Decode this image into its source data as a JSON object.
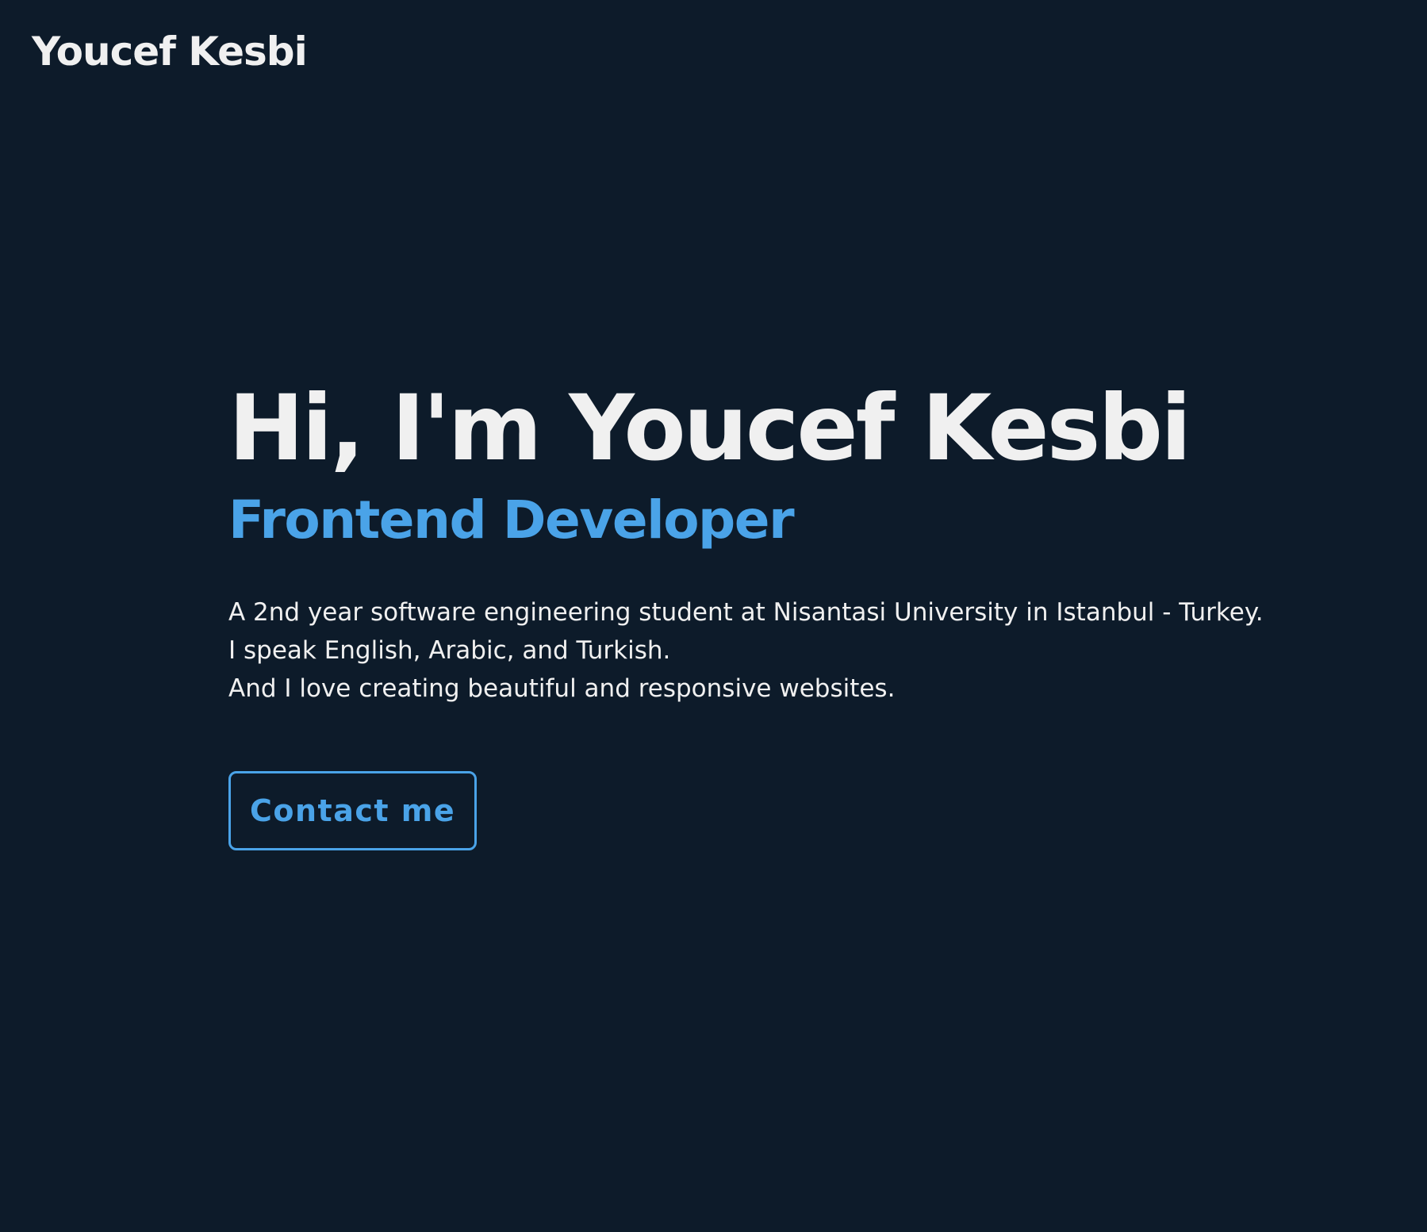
{
  "header": {
    "logo_text": "Youcef Kesbi"
  },
  "hero": {
    "title": "Hi, I'm Youcef Kesbi",
    "subtitle": "Frontend Developer",
    "description": [
      "A 2nd year software engineering student at Nisantasi University in Istanbul - Turkey.",
      "I speak English, Arabic, and Turkish.",
      "And I love creating beautiful and responsive websites."
    ],
    "cta_label": "Contact me"
  },
  "colors": {
    "background": "#0d1b2a",
    "text": "#f0f0f0",
    "accent": "#4aa3e8"
  }
}
